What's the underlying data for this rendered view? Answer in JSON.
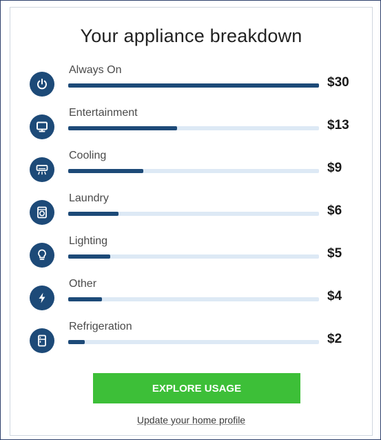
{
  "title": "Your appliance breakdown",
  "colors": {
    "accent": "#1d4a78",
    "track": "#dde9f5",
    "button": "#3dbf38"
  },
  "items": [
    {
      "label": "Always On",
      "amount": "$30",
      "value": 30,
      "icon": "power-icon"
    },
    {
      "label": "Entertainment",
      "amount": "$13",
      "value": 13,
      "icon": "monitor-icon"
    },
    {
      "label": "Cooling",
      "amount": "$9",
      "value": 9,
      "icon": "air-conditioner-icon"
    },
    {
      "label": "Laundry",
      "amount": "$6",
      "value": 6,
      "icon": "washing-machine-icon"
    },
    {
      "label": "Lighting",
      "amount": "$5",
      "value": 5,
      "icon": "lightbulb-icon"
    },
    {
      "label": "Other",
      "amount": "$4",
      "value": 4,
      "icon": "lightning-icon"
    },
    {
      "label": "Refrigeration",
      "amount": "$2",
      "value": 2,
      "icon": "refrigerator-icon"
    }
  ],
  "actions": {
    "explore_label": "EXPLORE USAGE",
    "update_label": "Update your home profile"
  }
}
